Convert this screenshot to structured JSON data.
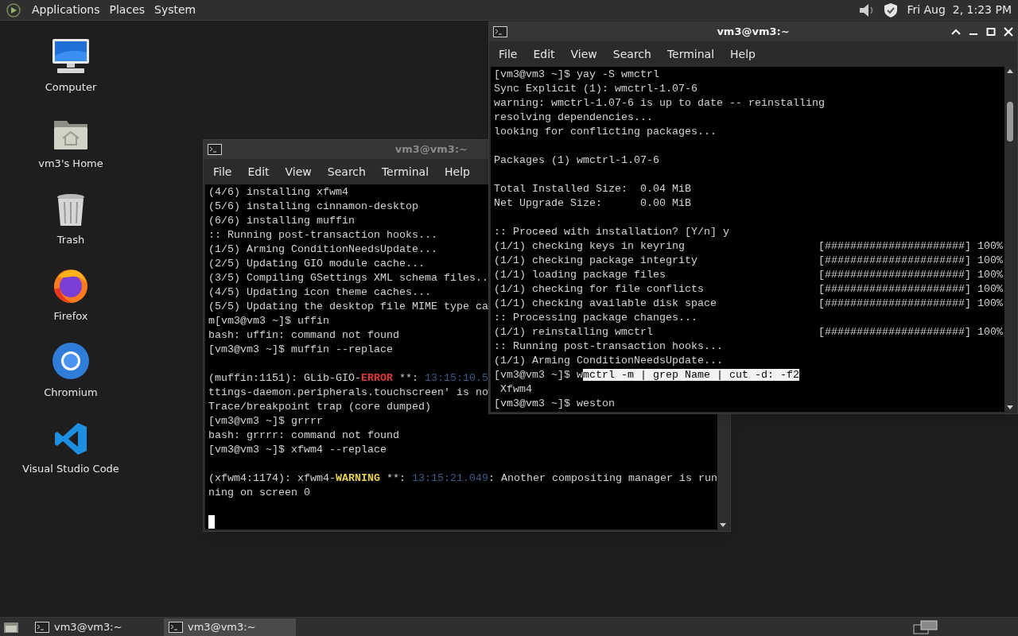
{
  "top_panel": {
    "menus": [
      "Applications",
      "Places",
      "System"
    ],
    "clock": "Fri Aug  2, 1:23 PM"
  },
  "desktop_icons": [
    {
      "label": "Computer",
      "kind": "computer"
    },
    {
      "label": "vm3's Home",
      "kind": "home"
    },
    {
      "label": "Trash",
      "kind": "trash"
    },
    {
      "label": "Firefox",
      "kind": "firefox"
    },
    {
      "label": "Chromium",
      "kind": "chromium"
    },
    {
      "label": "Visual Studio Code",
      "kind": "vscode"
    }
  ],
  "windows": [
    {
      "title": "vm3@vm3:~",
      "focused": false,
      "menus": [
        "File",
        "Edit",
        "View",
        "Search",
        "Terminal",
        "Help"
      ],
      "lines": [
        {
          "kind": "text",
          "parts": [
            {
              "kind": "plain",
              "text": "(4/6) installing xfwm4"
            }
          ]
        },
        {
          "kind": "text",
          "parts": [
            {
              "kind": "plain",
              "text": "(5/6) installing cinnamon-desktop"
            }
          ]
        },
        {
          "kind": "text",
          "parts": [
            {
              "kind": "plain",
              "text": "(6/6) installing muffin"
            }
          ]
        },
        {
          "kind": "text",
          "parts": [
            {
              "kind": "plain",
              "text": ":: Running post-transaction hooks..."
            }
          ]
        },
        {
          "kind": "text",
          "parts": [
            {
              "kind": "plain",
              "text": "(1/5) Arming ConditionNeedsUpdate..."
            }
          ]
        },
        {
          "kind": "text",
          "parts": [
            {
              "kind": "plain",
              "text": "(2/5) Updating GIO module cache..."
            }
          ]
        },
        {
          "kind": "text",
          "parts": [
            {
              "kind": "plain",
              "text": "(3/5) Compiling GSettings XML schema files.."
            }
          ]
        },
        {
          "kind": "text",
          "parts": [
            {
              "kind": "plain",
              "text": "(4/5) Updating icon theme caches..."
            }
          ]
        },
        {
          "kind": "text",
          "parts": [
            {
              "kind": "plain",
              "text": "(5/5) Updating the desktop file MIME type ca"
            }
          ]
        },
        {
          "kind": "text",
          "parts": [
            {
              "kind": "plain",
              "text": "m[vm3@vm3 ~]$ uffin"
            }
          ]
        },
        {
          "kind": "text",
          "parts": [
            {
              "kind": "plain",
              "text": "bash: uffin: command not found"
            }
          ]
        },
        {
          "kind": "text",
          "parts": [
            {
              "kind": "plain",
              "text": "[vm3@vm3 ~]$ muffin --replace"
            }
          ]
        },
        {
          "kind": "blank"
        },
        {
          "kind": "text",
          "parts": [
            {
              "kind": "plain",
              "text": "(muffin:1151): GLib-GIO-"
            },
            {
              "kind": "error",
              "text": "ERROR"
            },
            {
              "kind": "plain",
              "text": " **: "
            },
            {
              "kind": "time",
              "text": "13:15:10.5"
            }
          ]
        },
        {
          "kind": "text",
          "parts": [
            {
              "kind": "plain",
              "text": "ttings-daemon.peripherals.touchscreen' is no"
            }
          ]
        },
        {
          "kind": "text",
          "parts": [
            {
              "kind": "plain",
              "text": "Trace/breakpoint trap (core dumped)"
            }
          ]
        },
        {
          "kind": "text",
          "parts": [
            {
              "kind": "plain",
              "text": "[vm3@vm3 ~]$ grrrr"
            }
          ]
        },
        {
          "kind": "text",
          "parts": [
            {
              "kind": "plain",
              "text": "bash: grrrr: command not found"
            }
          ]
        },
        {
          "kind": "text",
          "parts": [
            {
              "kind": "plain",
              "text": "[vm3@vm3 ~]$ xfwm4 --replace"
            }
          ]
        },
        {
          "kind": "blank"
        },
        {
          "kind": "text",
          "parts": [
            {
              "kind": "plain",
              "text": "(xfwm4:1174): xfwm4-"
            },
            {
              "kind": "warning",
              "text": "WARNING"
            },
            {
              "kind": "plain",
              "text": " **: "
            },
            {
              "kind": "time",
              "text": "13:15:21.049"
            },
            {
              "kind": "plain",
              "text": ": Another compositing manager is run"
            }
          ]
        },
        {
          "kind": "text",
          "parts": [
            {
              "kind": "plain",
              "text": "ning on screen 0"
            }
          ]
        },
        {
          "kind": "blank"
        },
        {
          "kind": "cursor"
        }
      ]
    },
    {
      "title": "vm3@vm3:~",
      "focused": true,
      "menus": [
        "File",
        "Edit",
        "View",
        "Search",
        "Terminal",
        "Help"
      ],
      "lines": [
        {
          "kind": "text",
          "parts": [
            {
              "kind": "plain",
              "text": "[vm3@vm3 ~]$ yay -S wmctrl"
            }
          ]
        },
        {
          "kind": "text",
          "parts": [
            {
              "kind": "plain",
              "text": "Sync Explicit (1): wmctrl-1.07-6"
            }
          ]
        },
        {
          "kind": "text",
          "parts": [
            {
              "kind": "plain",
              "text": "warning: wmctrl-1.07-6 is up to date -- reinstalling"
            }
          ]
        },
        {
          "kind": "text",
          "parts": [
            {
              "kind": "plain",
              "text": "resolving dependencies..."
            }
          ]
        },
        {
          "kind": "text",
          "parts": [
            {
              "kind": "plain",
              "text": "looking for conflicting packages..."
            }
          ]
        },
        {
          "kind": "blank"
        },
        {
          "kind": "text",
          "parts": [
            {
              "kind": "plain",
              "text": "Packages (1) wmctrl-1.07-6"
            }
          ]
        },
        {
          "kind": "blank"
        },
        {
          "kind": "text",
          "parts": [
            {
              "kind": "plain",
              "text": "Total Installed Size:  0.04 MiB"
            }
          ]
        },
        {
          "kind": "text",
          "parts": [
            {
              "kind": "plain",
              "text": "Net Upgrade Size:      0.00 MiB"
            }
          ]
        },
        {
          "kind": "blank"
        },
        {
          "kind": "text",
          "parts": [
            {
              "kind": "plain",
              "text": ":: Proceed with installation? [Y/n] y"
            }
          ]
        },
        {
          "kind": "text",
          "parts": [
            {
              "kind": "plain",
              "text": "(1/1) checking keys in keyring"
            }
          ],
          "bar": "[######################] 100%"
        },
        {
          "kind": "text",
          "parts": [
            {
              "kind": "plain",
              "text": "(1/1) checking package integrity"
            }
          ],
          "bar": "[######################] 100%"
        },
        {
          "kind": "text",
          "parts": [
            {
              "kind": "plain",
              "text": "(1/1) loading package files"
            }
          ],
          "bar": "[######################] 100%"
        },
        {
          "kind": "text",
          "parts": [
            {
              "kind": "plain",
              "text": "(1/1) checking for file conflicts"
            }
          ],
          "bar": "[######################] 100%"
        },
        {
          "kind": "text",
          "parts": [
            {
              "kind": "plain",
              "text": "(1/1) checking available disk space"
            }
          ],
          "bar": "[######################] 100%"
        },
        {
          "kind": "text",
          "parts": [
            {
              "kind": "plain",
              "text": ":: Processing package changes..."
            }
          ]
        },
        {
          "kind": "text",
          "parts": [
            {
              "kind": "plain",
              "text": "(1/1) reinstalling wmctrl"
            }
          ],
          "bar": "[######################] 100%"
        },
        {
          "kind": "text",
          "parts": [
            {
              "kind": "plain",
              "text": ":: Running post-transaction hooks..."
            }
          ]
        },
        {
          "kind": "text",
          "parts": [
            {
              "kind": "plain",
              "text": "(1/1) Arming ConditionNeedsUpdate..."
            }
          ]
        },
        {
          "kind": "text",
          "parts": [
            {
              "kind": "plain",
              "text": "[vm3@vm3 ~]$ w"
            },
            {
              "kind": "selected",
              "text": "mctrl -m | grep Name | cut -d: -f2"
            }
          ]
        },
        {
          "kind": "text",
          "parts": [
            {
              "kind": "plain",
              "text": " Xfwm4"
            }
          ]
        },
        {
          "kind": "text",
          "parts": [
            {
              "kind": "plain",
              "text": "[vm3@vm3 ~]$ weston"
            }
          ]
        }
      ]
    }
  ],
  "taskbar": {
    "tasks": [
      {
        "label": "vm3@vm3:~",
        "selected": false
      },
      {
        "label": "vm3@vm3:~",
        "selected": true
      }
    ]
  }
}
